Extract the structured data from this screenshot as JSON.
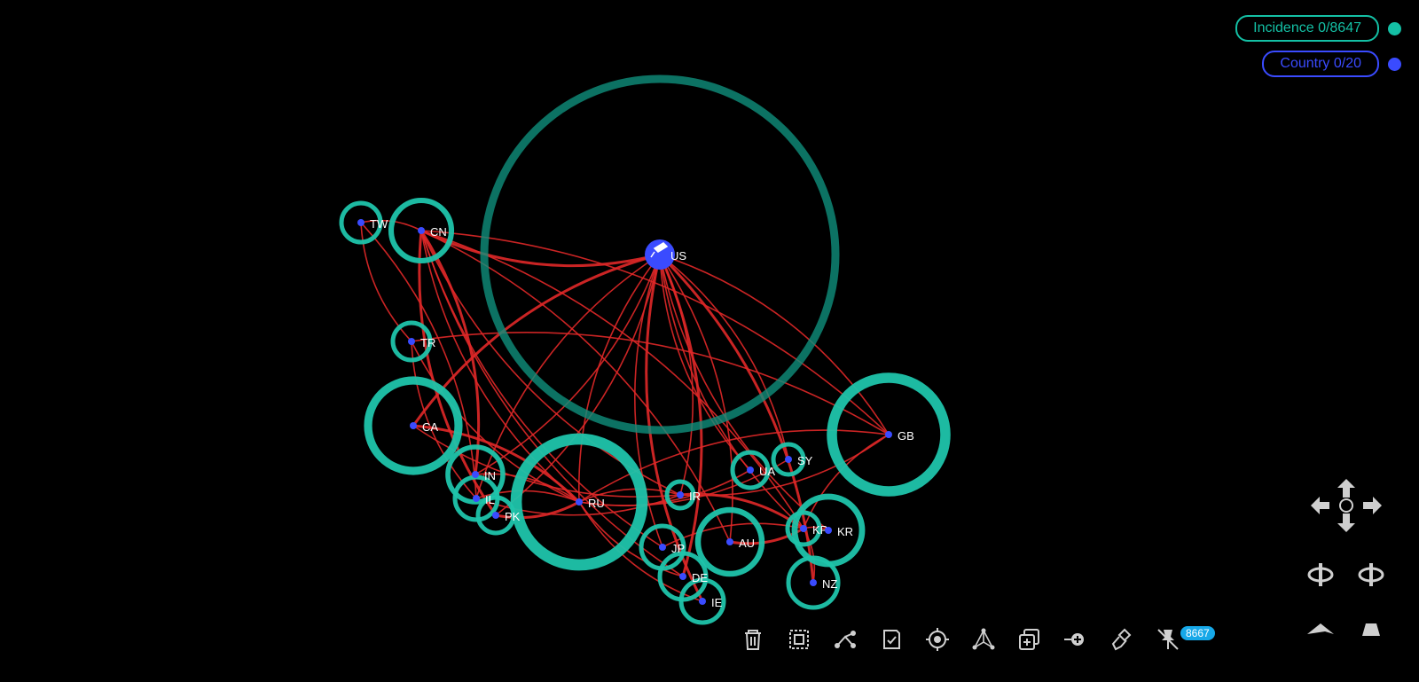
{
  "legend": {
    "incidence": {
      "label": "Incidence 0/8647",
      "color": "#14c0a5"
    },
    "country": {
      "label": "Country 0/20",
      "color": "#3a4bff"
    }
  },
  "colors": {
    "ring": "#1fc4ab",
    "edge": "#e02828",
    "node": "#3a4bff",
    "background": "#000000"
  },
  "nodes": [
    {
      "id": "US",
      "label": "US"
    },
    {
      "id": "TW",
      "label": "TW"
    },
    {
      "id": "CN",
      "label": "CN"
    },
    {
      "id": "TR",
      "label": "TR"
    },
    {
      "id": "CA",
      "label": "CA"
    },
    {
      "id": "IN",
      "label": "IN"
    },
    {
      "id": "IL",
      "label": "IL"
    },
    {
      "id": "PK",
      "label": "PK"
    },
    {
      "id": "RU",
      "label": "RU"
    },
    {
      "id": "IR",
      "label": "IR"
    },
    {
      "id": "UA",
      "label": "UA"
    },
    {
      "id": "SY",
      "label": "SY"
    },
    {
      "id": "GB",
      "label": "GB"
    },
    {
      "id": "KP",
      "label": "KP"
    },
    {
      "id": "KR",
      "label": "KR"
    },
    {
      "id": "JP",
      "label": "JP"
    },
    {
      "id": "AU",
      "label": "AU"
    },
    {
      "id": "DE",
      "label": "DE"
    },
    {
      "id": "NZ",
      "label": "NZ"
    },
    {
      "id": "IE",
      "label": "IE"
    }
  ],
  "toolbar": {
    "tools": [
      "trash-icon",
      "select-box-icon",
      "edge-merge-icon",
      "checklist-icon",
      "focus-target-icon",
      "graph-layout-icon",
      "duplicate-icon",
      "add-node-icon",
      "brush-icon",
      "unpin-icon"
    ],
    "badge": "8667"
  },
  "navigation": {
    "icons": [
      "arrow-up-icon",
      "arrow-left-icon",
      "center-icon",
      "arrow-right-icon",
      "arrow-down-icon",
      "rotate-left-icon",
      "rotate-right-icon",
      "tilt-down-icon",
      "tilt-up-icon"
    ]
  }
}
